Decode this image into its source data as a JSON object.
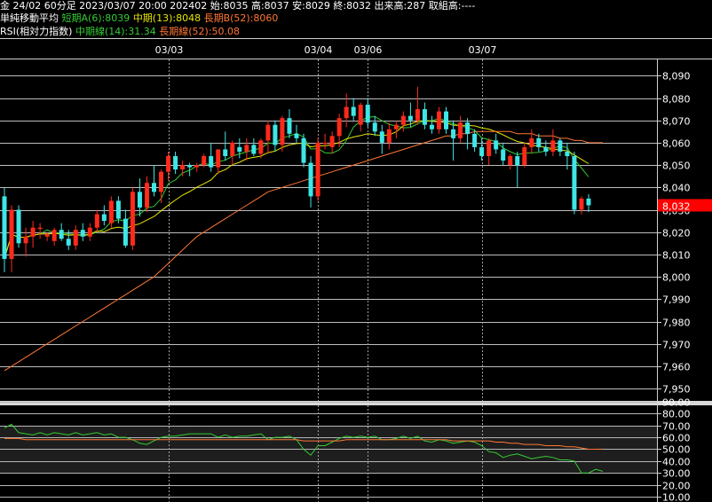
{
  "header": {
    "line1": "金 24/02 60分足 2023/03/07 20:00 202402 始:8035 高:8037 安:8029 終:8032 出来高:287 取組高:----",
    "ma_title": "単純移動平均",
    "ma_short": "短期A(6):8039",
    "ma_mid": "中期(13):8048",
    "ma_long": "長期B(52):8060",
    "rsi_title": "RSI(相対力指数)",
    "rsi_mid": "中期線(14):31.34",
    "rsi_long": "長期線(52):50.08"
  },
  "colors": {
    "up": "#ff2a1a",
    "down": "#3fe6e6",
    "ma_short": "#33cc33",
    "ma_mid": "#e6e600",
    "ma_long": "#ff7733",
    "last_price_bg": "#ff0000"
  },
  "chart_data": [
    {
      "type": "candlestick",
      "title": "金 24/02 60分足",
      "date_labels": [
        "03/03",
        "03/04",
        "03/06",
        "03/07"
      ],
      "yticks": [
        7950,
        7960,
        7970,
        7980,
        7990,
        8000,
        8010,
        8020,
        8030,
        8040,
        8050,
        8060,
        8070,
        8080,
        8090
      ],
      "ytick_labels": [
        "7,950",
        "7,960",
        "7,970",
        "7,980",
        "7,990",
        "8,000",
        "8,010",
        "8,020",
        "8,030",
        "8,040",
        "8,050",
        "8,060",
        "8,070",
        "8,080",
        "8,090"
      ],
      "ylim": [
        7945,
        8095
      ],
      "last_price": "8,032",
      "ohlc": [
        [
          8036,
          8040,
          8002,
          8008
        ],
        [
          8008,
          8032,
          8002,
          8030
        ],
        [
          8030,
          8032,
          8013,
          8015
        ],
        [
          8015,
          8022,
          8009,
          8018
        ],
        [
          8018,
          8025,
          8013,
          8022
        ],
        [
          8022,
          8024,
          8017,
          8022
        ],
        [
          8018,
          8020,
          8016,
          8019
        ],
        [
          8016,
          8022,
          8014,
          8021
        ],
        [
          8021,
          8024,
          8016,
          8017
        ],
        [
          8017,
          8021,
          8012,
          8014
        ],
        [
          8014,
          8023,
          8012,
          8021
        ],
        [
          8021,
          8024,
          8016,
          8018
        ],
        [
          8018,
          8024,
          8016,
          8022
        ],
        [
          8022,
          8030,
          8020,
          8028
        ],
        [
          8028,
          8032,
          8023,
          8025
        ],
        [
          8024,
          8036,
          8022,
          8034
        ],
        [
          8034,
          8036,
          8024,
          8026
        ],
        [
          8026,
          8030,
          8013,
          8014
        ],
        [
          8014,
          8040,
          8012,
          8038
        ],
        [
          8038,
          8044,
          8027,
          8031
        ],
        [
          8031,
          8045,
          8029,
          8042
        ],
        [
          8042,
          8050,
          8036,
          8038
        ],
        [
          8038,
          8048,
          8033,
          8047
        ],
        [
          8047,
          8056,
          8043,
          8054
        ],
        [
          8054,
          8056,
          8046,
          8048
        ],
        [
          8048,
          8052,
          8045,
          8050
        ],
        [
          8050,
          8051,
          8045,
          8049
        ],
        [
          8049,
          8051,
          8047,
          8050
        ],
        [
          8050,
          8055,
          8049,
          8054
        ],
        [
          8054,
          8060,
          8047,
          8049
        ],
        [
          8049,
          8057,
          8046,
          8057
        ],
        [
          8057,
          8065,
          8052,
          8054
        ],
        [
          8054,
          8061,
          8050,
          8060
        ],
        [
          8058,
          8062,
          8053,
          8056
        ],
        [
          8056,
          8062,
          8052,
          8059
        ],
        [
          8059,
          8062,
          8054,
          8055
        ],
        [
          8055,
          8062,
          8053,
          8061
        ],
        [
          8061,
          8070,
          8055,
          8068
        ],
        [
          8068,
          8070,
          8056,
          8059
        ],
        [
          8059,
          8072,
          8056,
          8071
        ],
        [
          8071,
          8075,
          8062,
          8064
        ],
        [
          8064,
          8068,
          8060,
          8062
        ],
        [
          8062,
          8064,
          8049,
          8051
        ],
        [
          8051,
          8054,
          8031,
          8036
        ],
        [
          8036,
          8062,
          8034,
          8060
        ],
        [
          8060,
          8064,
          8057,
          8060
        ],
        [
          8058,
          8065,
          8055,
          8063
        ],
        [
          8063,
          8073,
          8058,
          8071
        ],
        [
          8071,
          8082,
          8067,
          8076
        ],
        [
          8076,
          8080,
          8070,
          8072
        ],
        [
          8068,
          8078,
          8065,
          8077
        ],
        [
          8077,
          8080,
          8067,
          8069
        ],
        [
          8069,
          8072,
          8063,
          8065
        ],
        [
          8065,
          8068,
          8055,
          8060
        ],
        [
          8060,
          8069,
          8057,
          8066
        ],
        [
          8066,
          8070,
          8062,
          8068
        ],
        [
          8068,
          8074,
          8065,
          8072
        ],
        [
          8072,
          8078,
          8067,
          8070
        ],
        [
          8070,
          8085,
          8068,
          8075
        ],
        [
          8075,
          8078,
          8066,
          8068
        ],
        [
          8068,
          8072,
          8064,
          8066
        ],
        [
          8066,
          8076,
          8064,
          8074
        ],
        [
          8074,
          8076,
          8064,
          8066
        ],
        [
          8066,
          8070,
          8052,
          8062
        ],
        [
          8062,
          8072,
          8060,
          8069
        ],
        [
          8069,
          8071,
          8057,
          8064
        ],
        [
          8064,
          8066,
          8056,
          8058
        ],
        [
          8058,
          8062,
          8052,
          8054
        ],
        [
          8054,
          8062,
          8050,
          8061
        ],
        [
          8061,
          8064,
          8055,
          8057
        ],
        [
          8057,
          8060,
          8050,
          8052
        ],
        [
          8050,
          8055,
          8048,
          8054
        ],
        [
          8054,
          8056,
          8040,
          8050
        ],
        [
          8050,
          8060,
          8049,
          8058
        ],
        [
          8058,
          8066,
          8055,
          8062
        ],
        [
          8062,
          8064,
          8056,
          8058
        ],
        [
          8058,
          8061,
          8054,
          8056
        ],
        [
          8056,
          8066,
          8054,
          8061
        ],
        [
          8061,
          8062,
          8054,
          8056
        ],
        [
          8056,
          8060,
          8048,
          8054
        ],
        [
          8054,
          8056,
          8028,
          8030
        ],
        [
          8030,
          8036,
          8028,
          8035
        ],
        [
          8035,
          8037,
          8029,
          8032
        ]
      ]
    },
    {
      "type": "line",
      "title": "RSI(相対力指数)",
      "yticks": [
        10,
        20,
        30,
        40,
        50,
        60,
        70,
        80,
        90
      ],
      "ytick_labels": [
        "10.00",
        "20.00",
        "30.00",
        "40.00",
        "50.00",
        "60.00",
        "70.00",
        "80.00",
        "90.00"
      ],
      "ylim": [
        8,
        92
      ],
      "series": [
        {
          "name": "中期線(14)",
          "values": [
            68,
            71,
            64,
            63,
            62,
            64,
            62,
            64,
            63,
            62,
            64,
            62,
            63,
            64,
            62,
            63,
            60,
            60,
            58,
            55,
            54,
            57,
            60,
            61,
            61,
            62,
            63,
            63,
            63,
            63,
            60,
            62,
            60,
            61,
            61,
            62,
            63,
            58,
            60,
            60,
            61,
            58,
            50,
            45,
            53,
            53,
            56,
            59,
            61,
            60,
            61,
            60,
            61,
            58,
            58,
            59,
            61,
            59,
            61,
            57,
            56,
            58,
            57,
            55,
            56,
            57,
            56,
            53,
            48,
            47,
            43,
            45,
            46,
            44,
            42,
            43,
            44,
            43,
            41,
            41,
            40,
            30,
            30,
            33,
            31.34
          ]
        },
        {
          "name": "長期線(52)",
          "values": [
            59,
            59,
            59,
            58,
            58,
            58,
            58,
            58,
            58,
            58,
            58,
            58,
            58,
            58,
            58,
            58,
            58,
            58,
            58,
            58,
            58,
            58,
            58,
            58,
            58,
            58,
            58,
            58,
            58,
            58,
            58,
            58,
            58,
            58,
            58,
            58,
            58,
            58,
            58,
            58,
            58,
            58,
            57,
            57,
            57,
            57,
            57,
            57,
            58,
            58,
            58,
            58,
            58,
            58,
            58,
            58,
            58,
            58,
            58,
            58,
            58,
            58,
            58,
            57,
            57,
            57,
            57,
            57,
            57,
            56,
            56,
            55,
            55,
            54,
            54,
            54,
            53,
            53,
            53,
            52,
            52,
            51,
            50,
            50,
            50.08
          ]
        }
      ]
    }
  ]
}
